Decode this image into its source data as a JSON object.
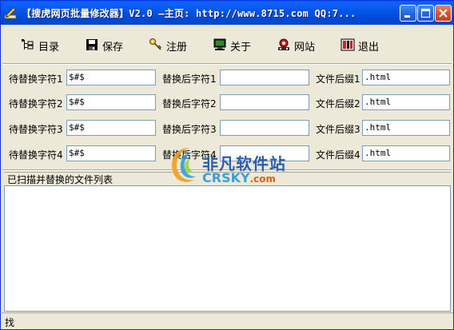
{
  "window": {
    "title": "【搜虎网页批量修改器】V2.0  —主页: http://www.8715.com QQ:7..."
  },
  "toolbar": {
    "items": [
      {
        "label": "目录",
        "icon": "directory-icon"
      },
      {
        "label": "保存",
        "icon": "save-icon"
      },
      {
        "label": "注册",
        "icon": "key-icon"
      },
      {
        "label": "关于",
        "icon": "monitor-icon"
      },
      {
        "label": "网站",
        "icon": "website-icon"
      },
      {
        "label": "退出",
        "icon": "exit-icon"
      }
    ]
  },
  "fields": [
    {
      "find_label": "待替换字符1",
      "find_value": "$#$",
      "replace_label": "替换后字符1",
      "replace_value": "",
      "suffix_label": "文件后缀1",
      "suffix_value": ".html"
    },
    {
      "find_label": "待替换字符2",
      "find_value": "$#$",
      "replace_label": "替换后字符2",
      "replace_value": "",
      "suffix_label": "文件后缀2",
      "suffix_value": ".html"
    },
    {
      "find_label": "待替换字符3",
      "find_value": "$#$",
      "replace_label": "替换后字符3",
      "replace_value": "",
      "suffix_label": "文件后缀3",
      "suffix_value": ".html"
    },
    {
      "find_label": "待替换字符4",
      "find_value": "$#$",
      "replace_label": "替换后字符4",
      "replace_value": "",
      "suffix_label": "文件后缀4",
      "suffix_value": ".html"
    }
  ],
  "file_list": {
    "header": "已扫描并替换的文件列表"
  },
  "status": {
    "text": "找"
  },
  "watermark": {
    "cn": "非凡软件站",
    "en": "CRSKY",
    "en_suffix": ".com"
  },
  "colors": {
    "titlebar": "#0055e5",
    "face": "#ece9d8",
    "input_border": "#7f9db9",
    "close_button": "#d8532a"
  }
}
